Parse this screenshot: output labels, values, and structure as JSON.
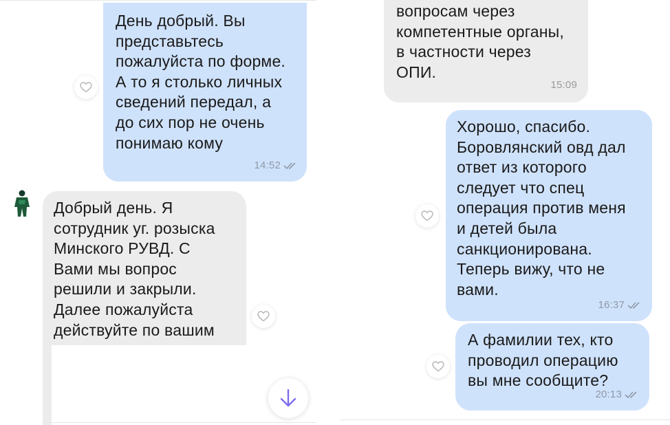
{
  "left_panel": {
    "messages": [
      {
        "direction": "outgoing",
        "text": "День добрый. Вы\nпредставьтесь\nпожалуйста по форме.\nА то я столько личных\nсведений передал, а\nдо сих пор не очень\nпонимаю кому",
        "time": "14:52",
        "status": "read",
        "reaction_icon": "heart-outline-icon"
      },
      {
        "direction": "incoming",
        "text": "Добрый день. Я\nсотрудник уг. розыска\nМинского РУВД. С\nВами мы вопрос\nрешили и закрыли.\nДалее пожалуйста\nдействуйте по вашим",
        "reaction_icon": "heart-outline-icon",
        "avatar_icon": "person-avatar-icon"
      }
    ],
    "scroll_down_icon": "arrow-down-icon"
  },
  "right_panel": {
    "messages": [
      {
        "direction": "incoming",
        "text": "вопросам через\nкомпетентные органы,\nв частности через\nОПИ.",
        "time": "15:09"
      },
      {
        "direction": "outgoing",
        "text": "Хорошо, спасибо.\nБоровлянский овд дал\nответ из которого\nследует что спец\nоперация против меня\nи детей была\nсанкционирована.\nТеперь вижу, что не\nвами.",
        "time": "16:37",
        "status": "read",
        "reaction_icon": "heart-outline-icon"
      },
      {
        "direction": "outgoing",
        "text": "А фамилии тех, кто\nпроводил операцию\nвы мне сообщите?",
        "time": "20:13",
        "status": "read",
        "reaction_icon": "heart-outline-icon"
      }
    ]
  },
  "colors": {
    "outgoing_bubble": "#cfe2fb",
    "incoming_bubble": "#ececec",
    "timestamp": "#8e99a8",
    "accent": "#7b6cf0"
  }
}
